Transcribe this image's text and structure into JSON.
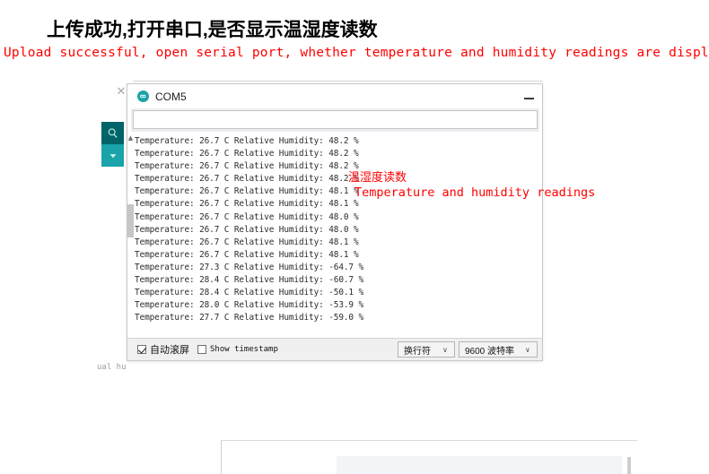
{
  "header": {
    "chinese": "上传成功,打开串口,是否显示温湿度读数",
    "english": "Upload successful, open serial port, whether temperature and humidity readings are displayed"
  },
  "annotation": {
    "chinese": "温湿度读数",
    "english": "Temperature and humidity readings",
    "color": "#ff0000"
  },
  "ide": {
    "tab_close_icon": "close-icon",
    "editor_fragment": "ual hu",
    "sidebar": [
      {
        "icon": "search-icon",
        "color": "#006468"
      },
      {
        "icon": "chevron-down-icon",
        "color": "#1aa3a8"
      }
    ]
  },
  "serial_monitor": {
    "title": "COM5",
    "logo_icon": "arduino-logo-icon",
    "minimize_label": "—",
    "send_input_value": "",
    "send_input_placeholder": "",
    "scroll_up_arrow": "▲",
    "lines": [
      "Temperature: 26.7 C Relative Humidity: 48.2 %",
      "Temperature: 26.7 C Relative Humidity: 48.2 %",
      "Temperature: 26.7 C Relative Humidity: 48.2 %",
      "Temperature: 26.7 C Relative Humidity: 48.2 %",
      "Temperature: 26.7 C Relative Humidity: 48.1 %",
      "Temperature: 26.7 C Relative Humidity: 48.1 %",
      "Temperature: 26.7 C Relative Humidity: 48.0 %",
      "Temperature: 26.7 C Relative Humidity: 48.0 %",
      "Temperature: 26.7 C Relative Humidity: 48.1 %",
      "Temperature: 26.7 C Relative Humidity: 48.1 %",
      "Temperature: 27.3 C Relative Humidity: -64.7 %",
      "Temperature: 28.4 C Relative Humidity: -60.7 %",
      "Temperature: 28.4 C Relative Humidity: -50.1 %",
      "Temperature: 28.0 C Relative Humidity: -53.9 %",
      "Temperature: 27.7 C Relative Humidity: -59.0 %"
    ],
    "bottom_bar": {
      "autoscroll_label": "自动滚屏",
      "autoscroll_checked": true,
      "timestamp_label": "Show timestamp",
      "timestamp_checked": false,
      "line_ending_value": "换行符",
      "baud_value": "9600 波特率",
      "caret_icon": "chevron-down-icon"
    }
  }
}
